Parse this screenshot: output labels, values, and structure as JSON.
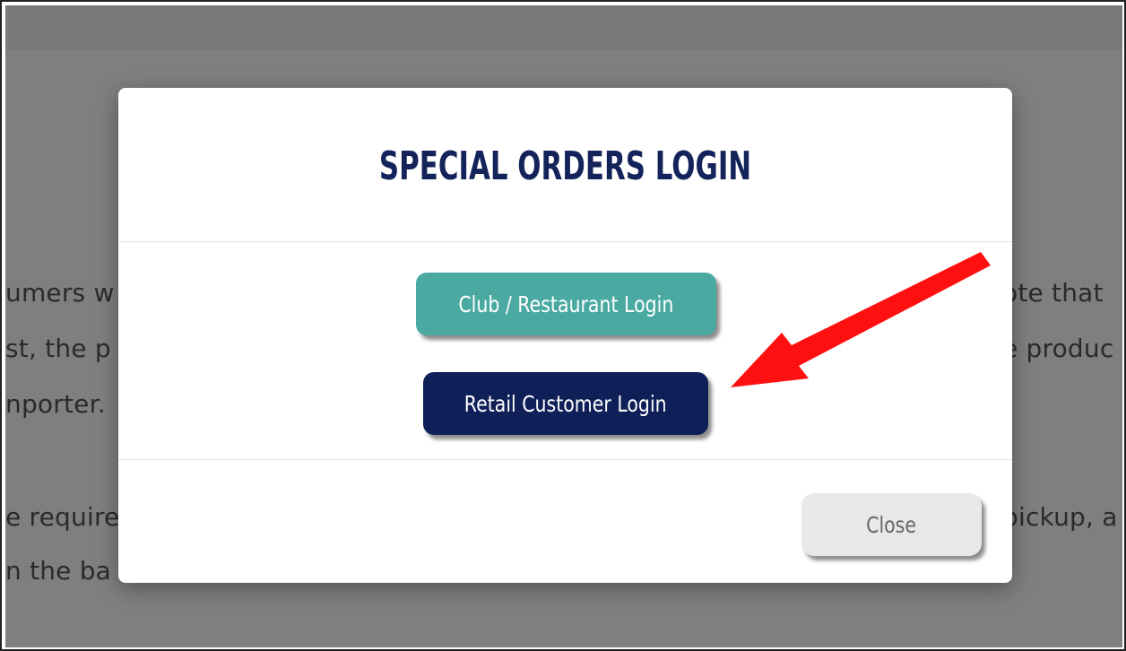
{
  "background_page": {
    "lines_left": [
      "umers w",
      "st, the p",
      "nporter.",
      "e require",
      "n the ba"
    ],
    "lines_right": [
      "ote that",
      "e produc",
      "pickup, a"
    ]
  },
  "modal": {
    "title": "SPECIAL ORDERS LOGIN",
    "buttons": {
      "club_label": "Club / Restaurant Login",
      "retail_label": "Retail Customer Login",
      "close_label": "Close"
    }
  },
  "colors": {
    "title": "#14245a",
    "club_button": "#4aa9a1",
    "retail_button": "#0f1f57",
    "close_button": "#e8e8e8",
    "annotation_arrow": "#ff1010"
  },
  "annotation": {
    "icon": "red-arrow-icon"
  }
}
